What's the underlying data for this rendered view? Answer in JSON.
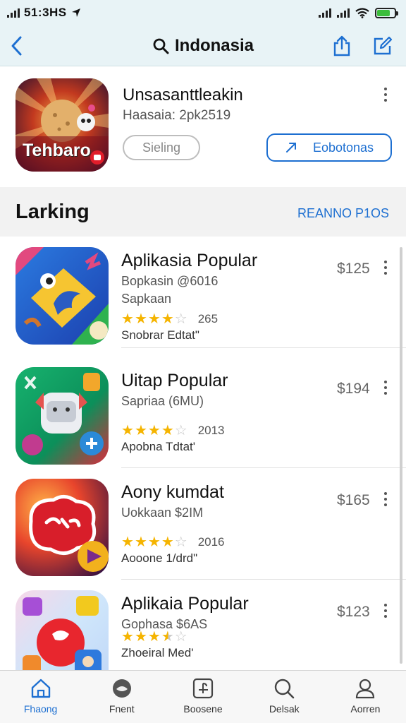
{
  "status_bar": {
    "time": "51:3HS",
    "battery_level": 0.75
  },
  "nav": {
    "title": "Indonasia",
    "icons": [
      "chevron-left-icon",
      "search-icon",
      "share-icon",
      "edit-icon"
    ]
  },
  "featured": {
    "title": "Unsasanttleakin",
    "subtitle": "Haasaia: 2pk2519",
    "icon_text": "Tehbaro",
    "button_secondary": "Sieling",
    "button_primary": "Eobotonas"
  },
  "section": {
    "title": "Larking",
    "link": "REANNO P1OS"
  },
  "apps": [
    {
      "title": "Aplikasia Popular",
      "subtitle": "Bopkasin @6016",
      "category": "Sapkaan",
      "rating": 4,
      "rating_count": "265",
      "note": "Snobrar Edtat\"",
      "price": "$125"
    },
    {
      "title": "Uitap Popular",
      "subtitle": "Sapriaa (6MU)",
      "category": "",
      "rating": 4,
      "rating_count": "2013",
      "note": "Apobna Tdtat'",
      "price": "$194"
    },
    {
      "title": "Aony kumdat",
      "subtitle": "Uokkaan $2IM",
      "category": "",
      "rating": 4,
      "rating_count": "2016",
      "note": "Aooone 1/drd\"",
      "price": "$165"
    },
    {
      "title": "Aplikaia Popular",
      "subtitle": "Gophasa $6AS",
      "category": "",
      "rating": 3.5,
      "rating_count": "",
      "note": "Zhoeiral Med'",
      "price": "$123"
    }
  ],
  "tabs": [
    {
      "label": "Fhaong",
      "icon": "home-icon",
      "active": true
    },
    {
      "label": "Fnent",
      "icon": "discover-icon",
      "active": false
    },
    {
      "label": "Boosene",
      "icon": "apps-icon",
      "active": false
    },
    {
      "label": "Delsak",
      "icon": "search-icon",
      "active": false
    },
    {
      "label": "Aorren",
      "icon": "account-icon",
      "active": false
    }
  ],
  "colors": {
    "accent": "#1d6fd1",
    "header_bg": "#e8f3f6",
    "star": "#f5b400"
  }
}
